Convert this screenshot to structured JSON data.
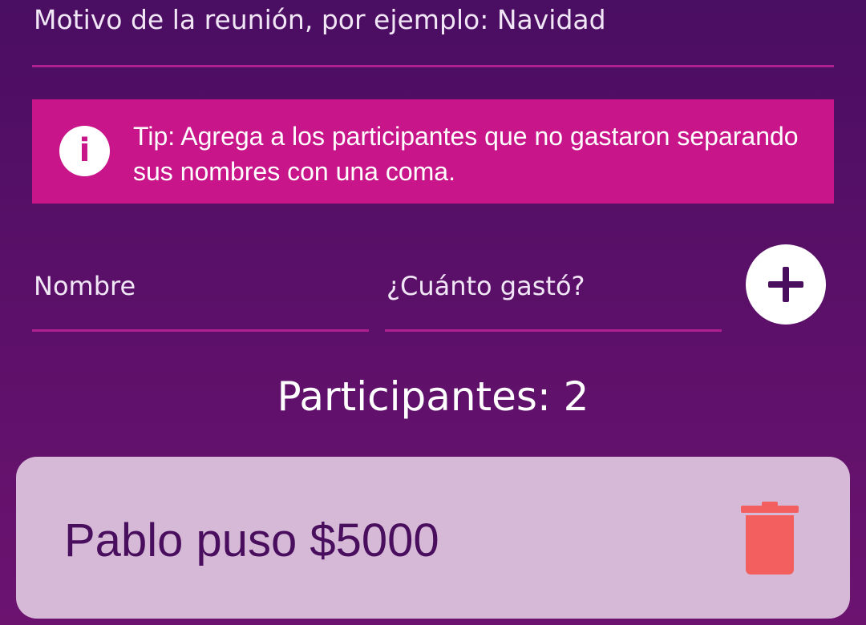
{
  "form": {
    "reason_placeholder": "Motivo de la reunión, por ejemplo: Navidad",
    "name_placeholder": "Nombre",
    "amount_placeholder": "¿Cuánto gastó?",
    "add_icon": "plus-icon"
  },
  "tip": {
    "icon": "info-icon",
    "icon_glyph": "i",
    "text": "Tip: Agrega a los participantes que no gastaron separando sus nombres con una coma."
  },
  "participants": {
    "title": "Participantes: 2",
    "items": [
      {
        "text": "Pablo puso $5000",
        "delete_icon": "trash-icon"
      }
    ]
  },
  "colors": {
    "background_top": "#4a0e62",
    "background_bottom": "#6c1370",
    "accent": "#c8168a",
    "card": "#d5b9d6",
    "card_text": "#4a0e5e",
    "delete": "#f35f5f"
  }
}
